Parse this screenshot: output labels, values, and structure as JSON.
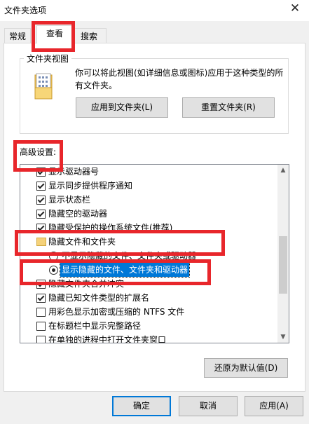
{
  "window": {
    "title": "文件夹选项",
    "close_glyph": "✕"
  },
  "tabs": [
    {
      "label": "常规",
      "active": false
    },
    {
      "label": "查看",
      "active": true
    },
    {
      "label": "搜索",
      "active": false
    }
  ],
  "folder_view": {
    "legend": "文件夹视图",
    "description": "你可以将此视图(如详细信息或图标)应用于这种类型的所有文件夹。",
    "apply_button": "应用到文件夹(L)",
    "reset_button": "重置文件夹(R)"
  },
  "advanced": {
    "label": "高级设置:",
    "items": [
      {
        "type": "checkbox",
        "checked": true,
        "label": "显示驱动器号"
      },
      {
        "type": "checkbox",
        "checked": true,
        "label": "显示同步提供程序通知"
      },
      {
        "type": "checkbox",
        "checked": true,
        "label": "显示状态栏"
      },
      {
        "type": "checkbox",
        "checked": true,
        "label": "隐藏空的驱动器"
      },
      {
        "type": "checkbox",
        "checked": true,
        "label": "隐藏受保护的操作系统文件(推荐)"
      },
      {
        "type": "folder",
        "label": "隐藏文件和文件夹"
      },
      {
        "type": "radio",
        "checked": false,
        "label": "不显示隐藏的文件、文件夹或驱动器"
      },
      {
        "type": "radio",
        "checked": true,
        "label": "显示隐藏的文件、文件夹和驱动器",
        "selected": true
      },
      {
        "type": "checkbox",
        "checked": true,
        "label": "隐藏文件夹合并冲突"
      },
      {
        "type": "checkbox",
        "checked": true,
        "label": "隐藏已知文件类型的扩展名"
      },
      {
        "type": "checkbox",
        "checked": false,
        "label": "用彩色显示加密或压缩的 NTFS 文件"
      },
      {
        "type": "checkbox",
        "checked": false,
        "label": "在标题栏中显示完整路径"
      },
      {
        "type": "checkbox",
        "checked": false,
        "label": "在单独的进程中打开文件夹窗口"
      }
    ],
    "restore_button": "还原为默认值(D)"
  },
  "footer": {
    "ok": "确定",
    "cancel": "取消",
    "apply": "应用(A)"
  },
  "colors": {
    "highlight": "#e8262b",
    "selection": "#0078d7"
  }
}
